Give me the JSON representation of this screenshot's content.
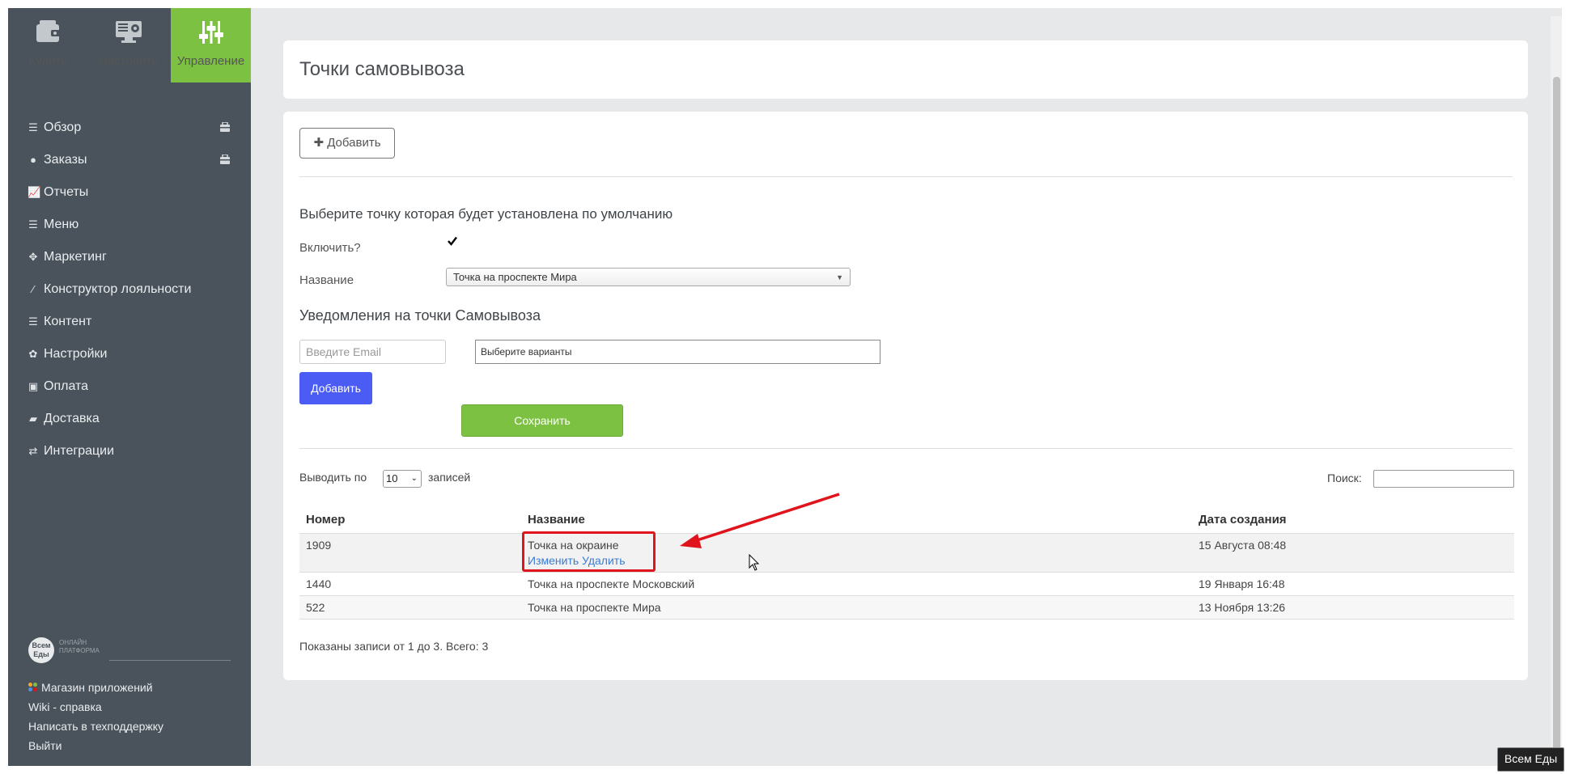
{
  "topnav": [
    {
      "label": "Купить",
      "icon": "wallet-icon",
      "active": false
    },
    {
      "label": "Настроить",
      "icon": "monitor-settings-icon",
      "active": false
    },
    {
      "label": "Управление",
      "icon": "sliders-icon",
      "active": true
    }
  ],
  "sidebar": {
    "items": [
      {
        "label": "Обзор",
        "icon": "list-icon",
        "badge": true
      },
      {
        "label": "Заказы",
        "icon": "circle-icon",
        "badge": true
      },
      {
        "label": "Отчеты",
        "icon": "chart-icon",
        "badge": false
      },
      {
        "label": "Меню",
        "icon": "list-icon",
        "badge": false
      },
      {
        "label": "Маркетинг",
        "icon": "crosshair-icon",
        "badge": false
      },
      {
        "label": "Конструктор лояльности",
        "icon": "magic-icon",
        "badge": false
      },
      {
        "label": "Контент",
        "icon": "list-icon",
        "badge": false
      },
      {
        "label": "Настройки",
        "icon": "gear-icon",
        "badge": false
      },
      {
        "label": "Оплата",
        "icon": "money-icon",
        "badge": false
      },
      {
        "label": "Доставка",
        "icon": "truck-icon",
        "badge": false
      },
      {
        "label": "Интеграции",
        "icon": "exchange-icon",
        "badge": false
      }
    ],
    "brand": {
      "logo_text": "Всем Еды",
      "tagline_1": "ОНЛАЙН",
      "tagline_2": "ПЛАТФОРМА"
    },
    "bottom_links": [
      {
        "label": "Магазин приложений"
      },
      {
        "label": "Wiki - справка"
      },
      {
        "label": "Написать в техподдержку"
      },
      {
        "label": "Выйти"
      }
    ]
  },
  "page": {
    "title": "Точки самовывоза"
  },
  "form": {
    "add_button": "✚ Добавить",
    "default_section_title": "Выберите точку которая будет установлена по умолчанию",
    "enable_label": "Включить?",
    "enable_checked": true,
    "name_label": "Название",
    "name_selected": "Точка на проспекте Мира",
    "notify_section_title": "Уведомления на точки Самовывоза",
    "email_placeholder": "Введите Email",
    "variants_placeholder": "Выберите варианты",
    "add_email_button": "Добавить",
    "save_button": "Сохранить"
  },
  "table": {
    "per_page_prefix": "Выводить по",
    "per_page_value": "10",
    "per_page_suffix": "записей",
    "search_label": "Поиск:",
    "headers": {
      "number": "Номер",
      "name": "Название",
      "created": "Дата создания"
    },
    "rows": [
      {
        "number": "1909",
        "name": "Точка на окраине",
        "created": "15 Августа 08:48",
        "edit": "Изменить",
        "delete": "Удалить"
      },
      {
        "number": "1440",
        "name": "Точка на проспекте Московский",
        "created": "19 Января 16:48"
      },
      {
        "number": "522",
        "name": "Точка на проспекте Мира",
        "created": "13 Ноября 13:26"
      }
    ],
    "info": "Показаны записи от 1 до 3. Всего: 3"
  },
  "tooltip": "Всем Еды",
  "colors": {
    "accent_green": "#7dc142",
    "sidebar_bg": "#4a535b",
    "primary_blue": "#4a5cf3",
    "annotation_red": "#e0141c"
  }
}
